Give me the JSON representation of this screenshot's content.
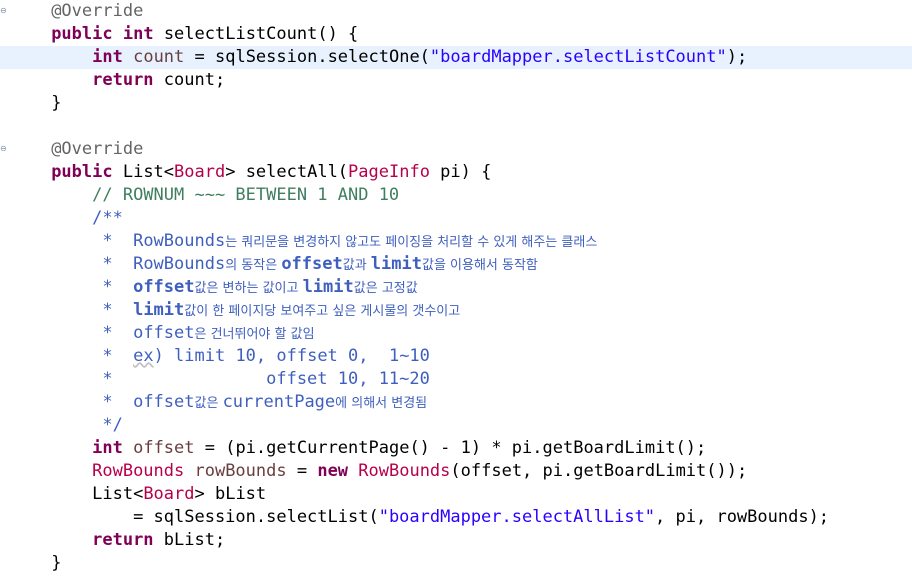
{
  "editor": {
    "method1": {
      "annotation": "@Override",
      "kw_public": "public",
      "kw_int": "int",
      "name": " selectListCount() {",
      "body_line1": {
        "kw": "int",
        "var": "count",
        "eq": " = sqlSession.selectOne(",
        "str": "\"boardMapper.selectListCount\"",
        "end": ");"
      },
      "body_line2": {
        "kw": "return",
        "rest": " count;"
      },
      "close": "}"
    },
    "method2": {
      "annotation": "@Override",
      "kw_public": "public",
      "sig_list": " List<",
      "sig_board": "Board",
      "sig_mid": "> selectAll(",
      "sig_pageinfo": "PageInfo",
      "sig_pi": " pi) {",
      "line_comment": "// ROWNUM ~~~ BETWEEN 1 AND 10",
      "doc_open": "/**",
      "doc_lines": [
        {
          "star": " *  ",
          "a": "RowBounds",
          "b": "는 쿼리문을 변경하지 않고도 페이징을 처리할 수 있게 해주는 클래스"
        },
        {
          "star": " *  ",
          "a": "RowBounds",
          "b": "의 동작은 ",
          "c": "offset",
          "d": "값과 ",
          "e": "limit",
          "f": "값을 이용해서 동작함"
        },
        {
          "star": " *  ",
          "a": "offset",
          "b": "값은 변하는 값이고 ",
          "c": "limit",
          "d": "값은 고정값"
        },
        {
          "star": " *  ",
          "a": "limit",
          "b": "값이 한 페이지당 보여주고 싶은 게시물의 갯수이고"
        },
        {
          "star": " *  ",
          "a": "offset",
          "b": "은 건너뛰어야 할 값임"
        }
      ],
      "doc_ex_star": " *  ",
      "doc_ex_word": "ex",
      "doc_ex_rest": ") limit 10, offset 0,  1~10",
      "doc_ex2": " *               offset 10, 11~20",
      "doc_last": {
        "star": " *  ",
        "a": "offset",
        "b": "값은 ",
        "c": "currentPage",
        "d": "에 의해서 변경됨"
      },
      "doc_close": " */",
      "offset_line": {
        "kw": "int",
        "var": "offset",
        "rest": " = (pi.getCurrentPage() - 1) * pi.getBoardLimit();"
      },
      "rb_line": {
        "type1": "RowBounds",
        "var": " rowBounds",
        "eq": " = ",
        "kw": "new",
        "type2": " RowBounds",
        "rest": "(offset, pi.getBoardLimit());"
      },
      "blist_line": {
        "a": "List<",
        "type": "Board",
        "b": "> bList"
      },
      "select_line": {
        "a": "= sqlSession.selectList(",
        "str": "\"boardMapper.selectAllList\"",
        "b": ", pi, rowBounds);"
      },
      "return_line": {
        "kw": "return",
        "rest": " bList;"
      },
      "close": "}"
    }
  }
}
